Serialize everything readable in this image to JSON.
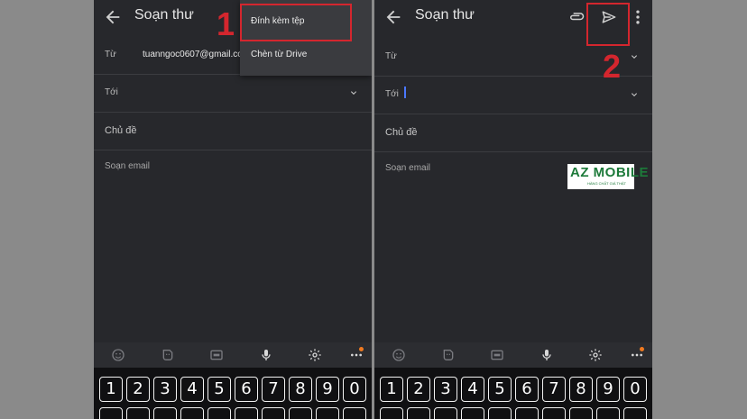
{
  "left": {
    "title": "Soạn thư",
    "from_label": "Từ",
    "from_value": "tuanngoc0607@gmail.co",
    "to_label": "Tới",
    "subject_placeholder": "Chủ đề",
    "body_placeholder": "Soạn email",
    "menu": [
      {
        "label": "Đính kèm tệp"
      },
      {
        "label": "Chèn từ Drive"
      }
    ],
    "step_number": "1"
  },
  "right": {
    "title": "Soạn thư",
    "from_label": "Từ",
    "to_label": "Tới",
    "subject_placeholder": "Chủ đề",
    "body_placeholder": "Soạn email",
    "step_number": "2",
    "logo_text": "AZ MOBILE",
    "logo_tagline": "HÀNG CHẤT GIÁ THẬT"
  },
  "keyboard": {
    "keys": [
      "1",
      "2",
      "3",
      "4",
      "5",
      "6",
      "7",
      "8",
      "9",
      "0"
    ],
    "toolbar_icons": [
      "emoji-icon",
      "sticker-icon",
      "gif-icon",
      "mic-icon",
      "settings-icon",
      "more-icon"
    ]
  },
  "colors": {
    "highlight": "#d4262e",
    "panel_bg": "#27282c",
    "keyboard_bg": "#101012",
    "notification_dot": "#f07a20"
  }
}
